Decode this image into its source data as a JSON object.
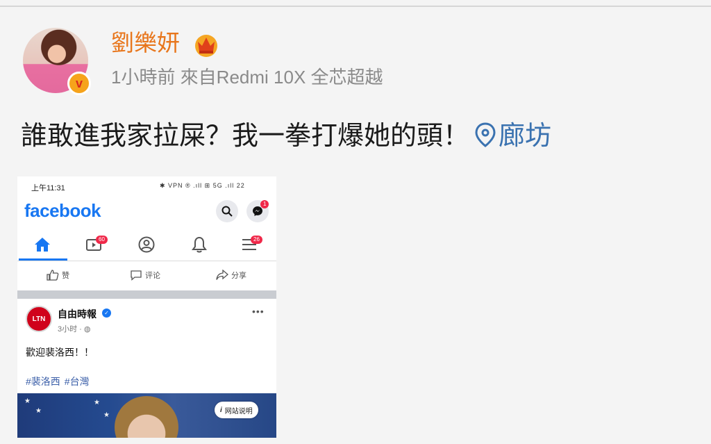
{
  "post": {
    "username": "劉樂妍",
    "meta": "1小時前 來自Redmi 10X 全芯超越",
    "text": "誰敢進我家拉屎？我一拳打爆她的頭！",
    "location": "廊坊",
    "badge_letter": "v"
  },
  "screenshot": {
    "status_time": "上午11:31",
    "status_right": "✱ VPN ® .ıll ⊞ 5G .ıll 22",
    "app_name": "facebook",
    "messenger_badge": "1",
    "watch_badge": "60",
    "menu_badge": "26",
    "actions": {
      "like": "赞",
      "comment": "评论",
      "share": "分享"
    },
    "page_post": {
      "avatar_text": "LTN",
      "page_name": "自由時報",
      "time": "3小时 · ",
      "text": "歡迎裴洛西！！",
      "tags": [
        "#裴洛西",
        "#台灣"
      ],
      "info_button": "网站说明"
    }
  },
  "colors": {
    "username": "#e8761c",
    "location": "#3a72b0",
    "facebook_blue": "#1877f2"
  }
}
